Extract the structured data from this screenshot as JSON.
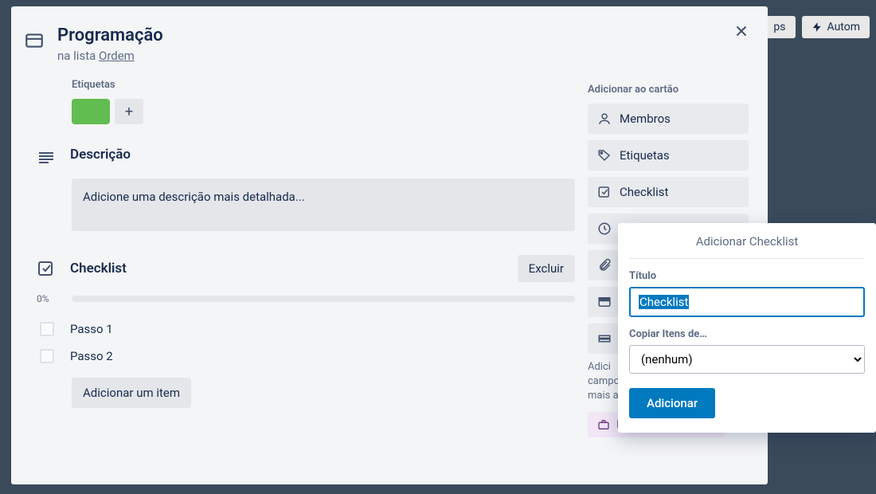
{
  "background": {
    "powerups": "ps",
    "automation": "Autom"
  },
  "header": {
    "title": "Programação",
    "in_list_prefix": "na lista ",
    "list_name": "Ordem"
  },
  "labels_section": {
    "title": "Etiquetas",
    "add_glyph": "+",
    "chips": [
      {
        "color": "#61bd4f"
      }
    ]
  },
  "description": {
    "title": "Descrição",
    "placeholder": "Adicione uma descrição mais detalhada..."
  },
  "checklist": {
    "title": "Checklist",
    "delete_label": "Excluir",
    "progress_pct": "0%",
    "items": [
      {
        "label": "Passo 1"
      },
      {
        "label": "Passo 2"
      }
    ],
    "add_item_label": "Adicionar um item"
  },
  "sidebar": {
    "section_title": "Adicionar ao cartão",
    "members": "Membros",
    "labels": "Etiquetas",
    "checklist": "Checklist",
    "note_line1": "Adici",
    "note_line2": "campo",
    "note_line3": "mais a",
    "trial": "Iniciar teste gratuito"
  },
  "popover": {
    "title": "Adicionar Checklist",
    "field_title_label": "Título",
    "field_title_value": "Checklist",
    "copy_label": "Copiar Itens de…",
    "copy_value": "(nenhum)",
    "submit": "Adicionar"
  }
}
